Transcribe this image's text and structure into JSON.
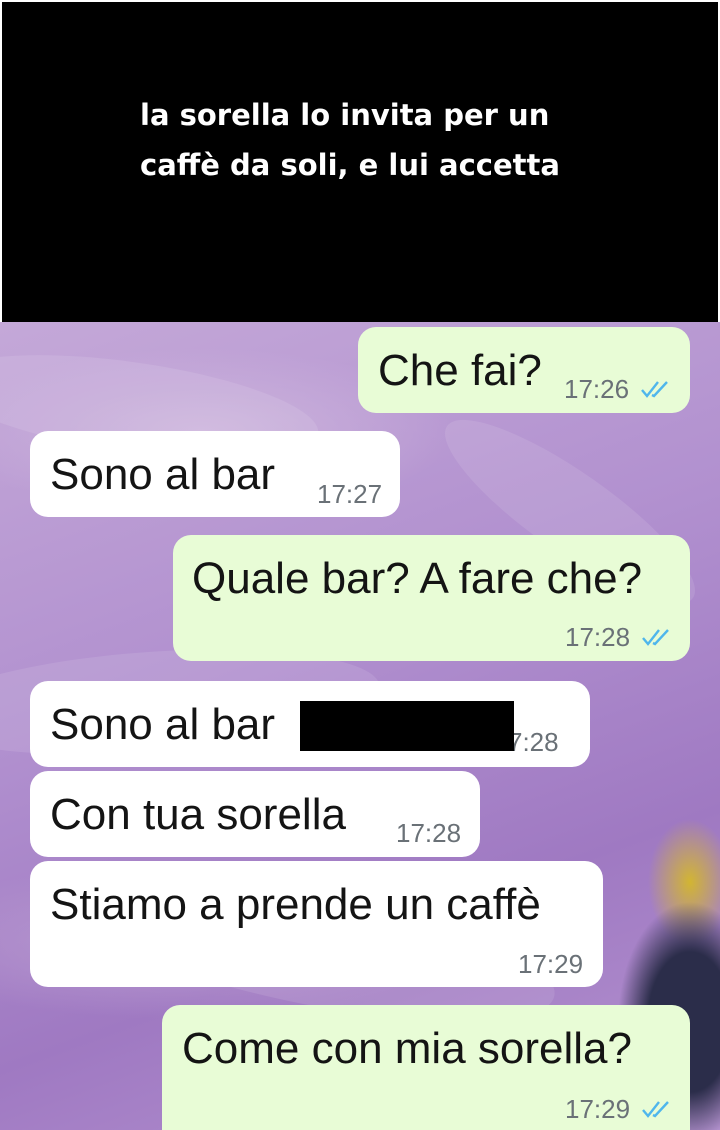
{
  "caption": {
    "line1": "la sorella lo invita per un",
    "line2": "caffè da soli, e lui accetta"
  },
  "colors": {
    "outgoing_bubble": "#e8fcd6",
    "incoming_bubble": "#ffffff",
    "read_ticks": "#4fb6ec",
    "timestamp": "#6a7177"
  },
  "messages": [
    {
      "direction": "out",
      "text": "Che fai?",
      "time": "17:26",
      "status_icon": "double-check-read-icon"
    },
    {
      "direction": "in",
      "text": "Sono al bar",
      "time": "17:27"
    },
    {
      "direction": "out",
      "text": "Quale bar? A fare che?",
      "time": "17:28",
      "status_icon": "double-check-read-icon"
    },
    {
      "direction": "in",
      "text": "Sono al bar",
      "time": "7:28",
      "redacted": true
    },
    {
      "direction": "in",
      "text": "Con tua sorella",
      "time": "17:28"
    },
    {
      "direction": "in",
      "text": "Stiamo a prende un caffè",
      "time": "17:29"
    },
    {
      "direction": "out",
      "text": "Come con mia sorella?",
      "time": "17:29",
      "status_icon": "double-check-read-icon"
    }
  ]
}
